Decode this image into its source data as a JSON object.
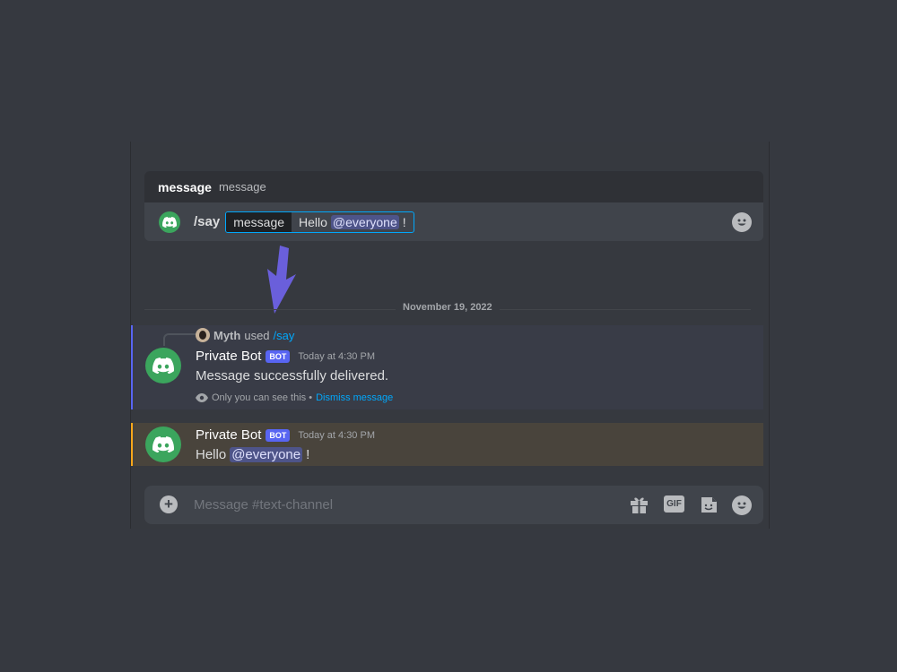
{
  "autocomplete": {
    "option_name": "message",
    "option_description": "message",
    "command": "/say",
    "param_name": "message",
    "param_value_prefix": "Hello",
    "param_value_mention": "@everyone",
    "param_value_suffix": "!"
  },
  "date_divider": "November 19, 2022",
  "messages": [
    {
      "reply_user": "Myth",
      "reply_used": "used",
      "reply_command": "/say",
      "username": "Private Bot",
      "tag": "BOT",
      "timestamp": "Today at 4:30 PM",
      "text": "Message successfully delivered.",
      "ephemeral_text": "Only you can see this •",
      "dismiss_label": "Dismiss message"
    },
    {
      "username": "Private Bot",
      "tag": "BOT",
      "timestamp": "Today at 4:30 PM",
      "text_prefix": "Hello",
      "mention": "@everyone",
      "text_suffix": "!"
    }
  ],
  "composer": {
    "placeholder": "Message #text-channel",
    "gif_label": "GIF"
  },
  "icons": [
    "discord-icon",
    "emoji-icon",
    "arrow-down-icon",
    "eye-icon",
    "add-icon",
    "gift-icon",
    "gif-icon",
    "sticker-icon"
  ],
  "colors": {
    "accent": "#5865f2",
    "link": "#00a8fc",
    "bot_green": "#3ba55d",
    "highlight_border": "#faa81a",
    "arrow": "#6a5fdb"
  }
}
